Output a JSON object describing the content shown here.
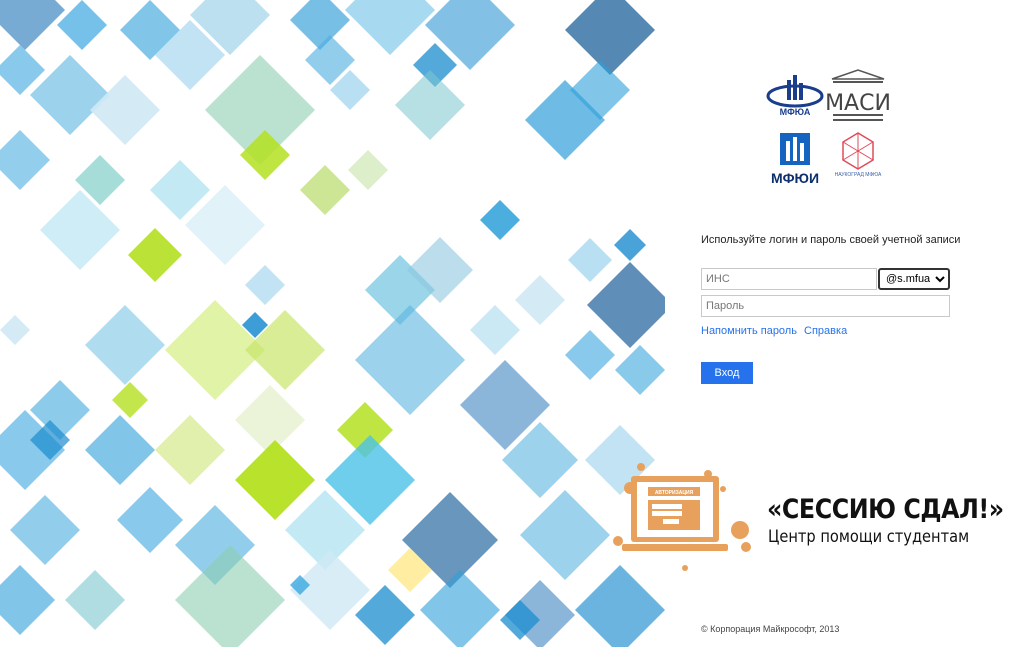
{
  "logos": {
    "mfua": "МФЮА",
    "masi": "МАСИ",
    "mfui": "МФЮИ",
    "naukograd": "НАУКОГРАД МФЮА"
  },
  "login": {
    "instruction": "Используйте логин и пароль своей учетной записи",
    "login_placeholder": "ИНС",
    "domain_value": "@s.mfua.ru",
    "password_placeholder": "Пароль",
    "remind_link": "Напомнить пароль",
    "help_link": "Справка",
    "submit_label": "Вход"
  },
  "banner": {
    "title": "«СЕССИЮ СДАЛ!»",
    "subtitle": "Центр помощи студентам",
    "screen_heading": "АВТОРИЗАЦИЯ"
  },
  "footer": {
    "copyright": "© Корпорация Майкрософт, 2013"
  },
  "colors": {
    "accent": "#2672ec",
    "banner_orange": "#e8a15c"
  }
}
